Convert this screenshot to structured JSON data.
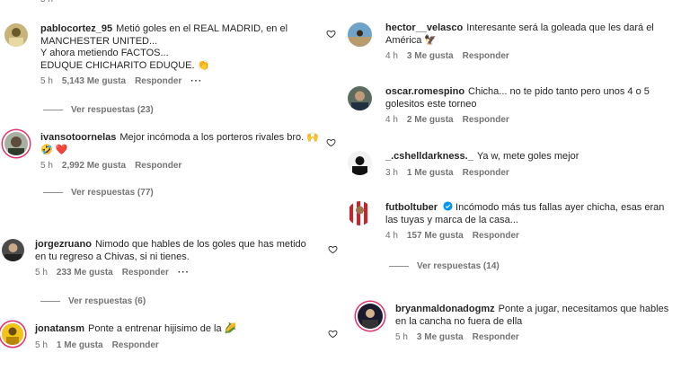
{
  "top_fragment": "5 h",
  "comments": [
    {
      "username": "pablocortez_95",
      "text": "Metió goles en el REAL MADRID, en el\nMANCHESTER UNITED...\nY ahora metiendo FACTOS...\nEDUQUE CHICHARITO EDUQUE.",
      "emoji": "👏",
      "time": "5 h",
      "likes": "5,143 Me gusta",
      "reply": "Responder",
      "more": "···",
      "view_replies": "Ver respuestas (23)"
    },
    {
      "username": "ivansotoornelas",
      "text": "Mejor incómoda a los porteros rivales bro.",
      "emoji": "🙌 🤣 ❤️",
      "time": "5 h",
      "likes": "2,992 Me gusta",
      "reply": "Responder",
      "view_replies": "Ver respuestas (77)"
    },
    {
      "username": "jorgezruano",
      "text": "Nimodo que hables de los goles que has metido\nen tu regreso a Chivas, si ni tienes.",
      "time": "5 h",
      "likes": "233 Me gusta",
      "reply": "Responder",
      "more": "···",
      "view_replies": "Ver respuestas (6)"
    },
    {
      "username": "jonatansm",
      "text": "Ponte a entrenar hijisimo de la",
      "emoji": "🌽",
      "time": "5 h",
      "likes": "1 Me gusta",
      "reply": "Responder"
    },
    {
      "username": "hector__velasco",
      "text": "Interesante será la goleada que les dará el\nAmérica",
      "emoji": "🦅",
      "time": "4 h",
      "likes": "3 Me gusta",
      "reply": "Responder"
    },
    {
      "username": "oscar.romespino",
      "text": "Chicha... no te pido tanto pero unos 4 o 5\ngolesitos este torneo",
      "time": "4 h",
      "likes": "2 Me gusta",
      "reply": "Responder"
    },
    {
      "username": "_.cshelldarkness._",
      "text": "Ya w, mete goles mejor",
      "time": "3 h",
      "likes": "1 Me gusta",
      "reply": "Responder"
    },
    {
      "username": "futboltuber",
      "text": "Incómodo más tus fallas ayer chicha, esas eran\nlas tuyas y marca de la casa...",
      "time": "4 h",
      "likes": "157 Me gusta",
      "reply": "Responder",
      "view_replies": "Ver respuestas (14)"
    },
    {
      "username": "bryanmaldonadogmz",
      "text": "Ponte a jugar, necesitamos que hables\nen la cancha no fuera de ella",
      "time": "5 h",
      "likes": "3 Me gusta",
      "reply": "Responder"
    }
  ],
  "colors": {
    "text": "#262626",
    "meta": "#737373",
    "ring": "#e1306c",
    "verified": "#0095f6"
  },
  "icons": {
    "like": "heart-outline-icon",
    "verified": "verified-badge-icon"
  }
}
